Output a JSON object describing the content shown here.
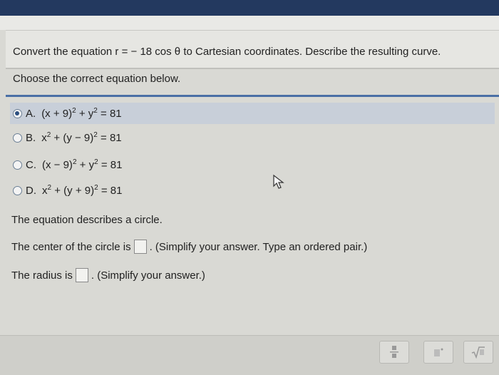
{
  "question": {
    "text": "Convert the equation r = − 18 cos θ to Cartesian coordinates. Describe the resulting curve."
  },
  "prompt": "Choose the correct equation below.",
  "options": [
    {
      "letter": "A.",
      "eq_a": "(x + 9)",
      "eq_b": " + y",
      "eq_c": " = 81",
      "selected": true
    },
    {
      "letter": "B.",
      "eq_a": "x",
      "eq_b": " + (y − 9)",
      "eq_c": " = 81",
      "selected": false
    },
    {
      "letter": "C.",
      "eq_a": "(x − 9)",
      "eq_b": " + y",
      "eq_c": " = 81",
      "selected": false
    },
    {
      "letter": "D.",
      "eq_a": "x",
      "eq_b": " + (y + 9)",
      "eq_c": " = 81",
      "selected": false
    }
  ],
  "exp": "2",
  "statement": "The equation describes a circle.",
  "center": {
    "label": "The center of the circle is",
    "hint": ". (Simplify your answer. Type an ordered pair.)"
  },
  "radius": {
    "label": "The radius is",
    "hint": ". (Simplify your answer.)"
  },
  "toolbar": {
    "fraction_icon": "fraction-icon",
    "dot_icon": "dot-icon",
    "sqrt_label": "√̅"
  },
  "colors": {
    "top_bar": "#23395f",
    "separator": "#4a6fa5",
    "selected_bg": "#c8cfd9"
  }
}
